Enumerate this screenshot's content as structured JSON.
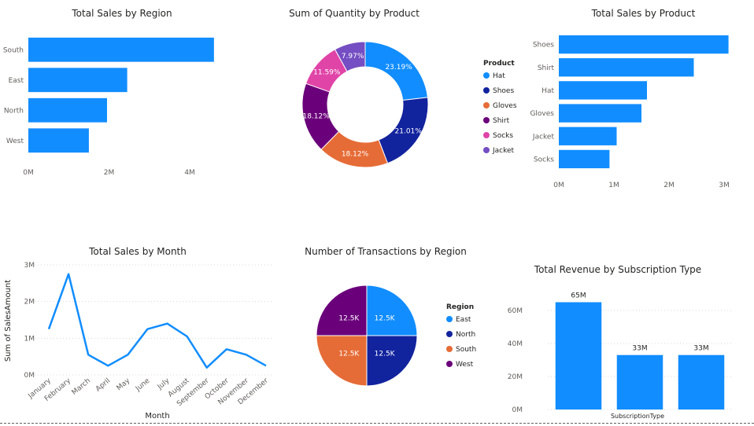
{
  "colors": {
    "blue": "#118DFF",
    "navy": "#12239E",
    "orange": "#E66C37",
    "purple": "#6B007B",
    "pink": "#E044A7",
    "violet": "#744EC2"
  },
  "chart_data": [
    {
      "id": "sales-region",
      "type": "bar",
      "orientation": "horizontal",
      "title": "Total Sales by Region",
      "categories": [
        "South",
        "East",
        "North",
        "West"
      ],
      "values": [
        4.6,
        2.45,
        1.95,
        1.5
      ],
      "xticks": [
        "0M",
        "2M",
        "4M"
      ],
      "xlim": [
        0,
        5.5
      ],
      "xlabel": "",
      "ylabel": "",
      "unit": "M"
    },
    {
      "id": "qty-product",
      "type": "pie",
      "donut": true,
      "title": "Sum of Quantity by Product",
      "legend_title": "Product",
      "legend_position": "right",
      "categories": [
        "Hat",
        "Shoes",
        "Gloves",
        "Shirt",
        "Socks",
        "Jacket"
      ],
      "values": [
        23.19,
        21.01,
        18.12,
        18.12,
        11.59,
        7.97
      ],
      "labels": [
        "23.19%",
        "21.01%",
        "18.12%",
        "18.12%",
        "11.59%",
        "7.97%"
      ],
      "colors": [
        "#118DFF",
        "#12239E",
        "#E66C37",
        "#6B007B",
        "#E044A7",
        "#744EC2"
      ]
    },
    {
      "id": "sales-product",
      "type": "bar",
      "orientation": "horizontal",
      "title": "Total Sales by Product",
      "categories": [
        "Shoes",
        "Shirt",
        "Hat",
        "Gloves",
        "Jacket",
        "Socks"
      ],
      "values": [
        3.08,
        2.45,
        1.6,
        1.5,
        1.05,
        0.92
      ],
      "xticks": [
        "0M",
        "1M",
        "2M",
        "3M"
      ],
      "xlim": [
        0,
        3.2
      ],
      "xlabel": "",
      "ylabel": "",
      "unit": "M"
    },
    {
      "id": "sales-month",
      "type": "line",
      "title": "Total Sales by Month",
      "categories": [
        "January",
        "February",
        "March",
        "April",
        "May",
        "June",
        "July",
        "August",
        "September",
        "October",
        "November",
        "December"
      ],
      "values": [
        1.25,
        2.75,
        0.55,
        0.25,
        0.55,
        1.25,
        1.4,
        1.05,
        0.2,
        0.7,
        0.55,
        0.25
      ],
      "yticks": [
        "0M",
        "1M",
        "2M",
        "3M"
      ],
      "ylim": [
        0,
        3
      ],
      "xlabel": "Month",
      "ylabel": "Sum of SalesAmount",
      "grid": true
    },
    {
      "id": "tx-region",
      "type": "pie",
      "title": "Number of Transactions by Region",
      "legend_title": "Region",
      "legend_position": "right",
      "categories": [
        "East",
        "North",
        "South",
        "West"
      ],
      "values": [
        12.5,
        12.5,
        12.5,
        12.5
      ],
      "labels": [
        "12.5K",
        "12.5K",
        "12.5K",
        "12.5K"
      ],
      "colors": [
        "#118DFF",
        "#12239E",
        "#E66C37",
        "#6B007B"
      ]
    },
    {
      "id": "rev-sub",
      "type": "bar",
      "orientation": "vertical",
      "title": "Total Revenue by Subscription Type",
      "categories": [
        "",
        "",
        ""
      ],
      "values": [
        65,
        33,
        33
      ],
      "labels": [
        "65M",
        "33M",
        "33M"
      ],
      "yticks": [
        "0M",
        "20M",
        "40M",
        "60M"
      ],
      "ylim": [
        0,
        70
      ],
      "xlabel": "SubscriptionType",
      "ylabel": "",
      "grid": true
    }
  ]
}
